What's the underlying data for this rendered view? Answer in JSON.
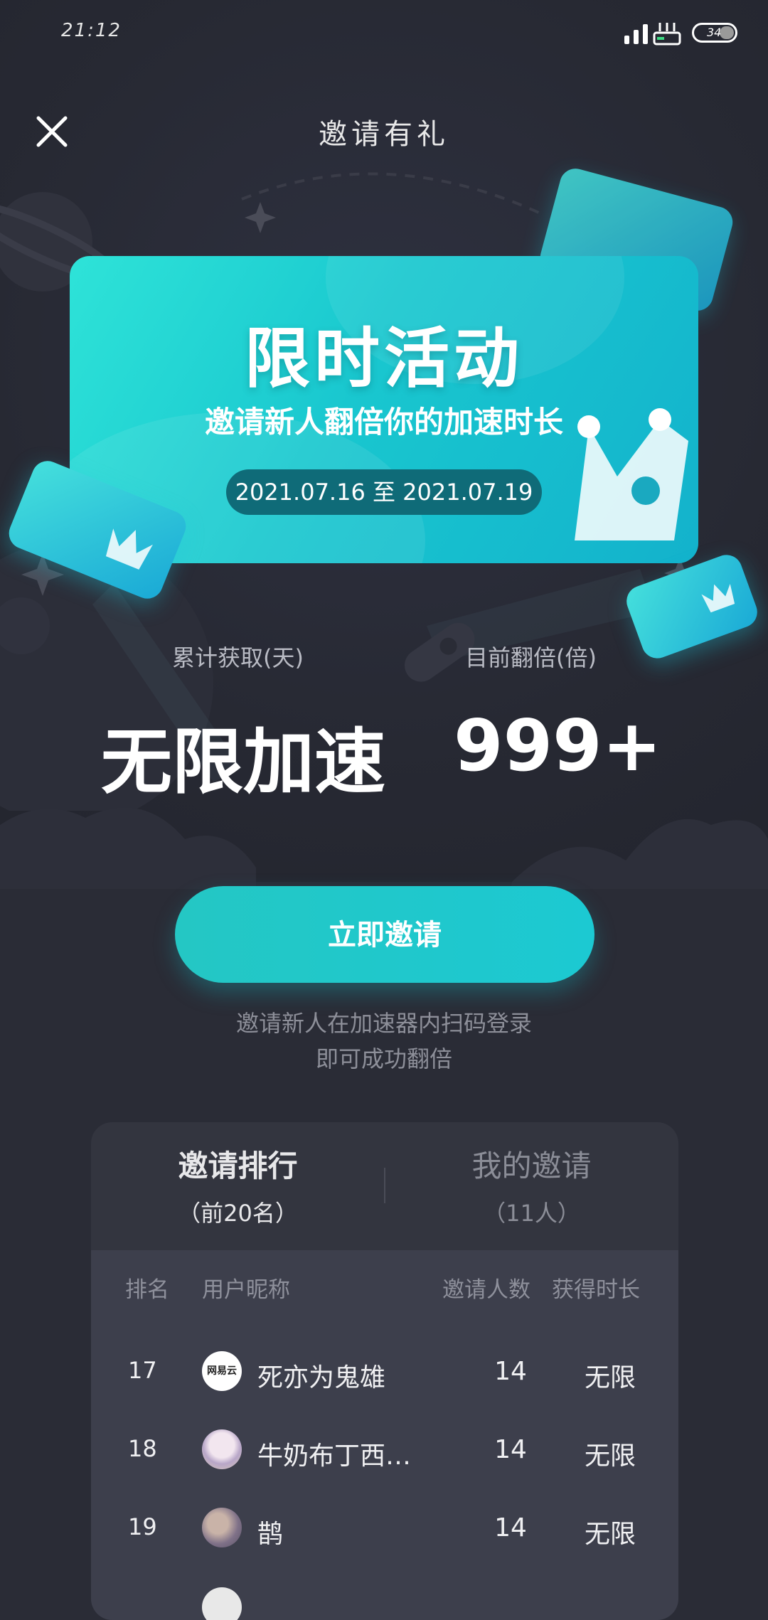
{
  "status_bar": {
    "time": "21:12",
    "battery": "34"
  },
  "header": {
    "title": "邀请有礼"
  },
  "banner": {
    "title": "限时活动",
    "subtitle": "邀请新人翻倍你的加速时长",
    "date_range": "2021.07.16 至 2021.07.19"
  },
  "stats": {
    "left_label": "累计获取(天)",
    "left_value": "无限加速",
    "right_label": "目前翻倍(倍)",
    "right_value": "999+"
  },
  "invite_button": "立即邀请",
  "hint": {
    "line1": "邀请新人在加速器内扫码登录",
    "line2": "即可成功翻倍"
  },
  "tabs": [
    {
      "label": "邀请排行",
      "sub": "（前20名）"
    },
    {
      "label": "我的邀请",
      "sub": "（11人）"
    }
  ],
  "table": {
    "headers": {
      "rank": "排名",
      "nickname": "用户昵称",
      "count": "邀请人数",
      "duration": "获得时长"
    },
    "rows": [
      {
        "rank": "17",
        "nickname": "死亦为鬼雄",
        "count": "14",
        "duration": "无限",
        "avatar": "网易云"
      },
      {
        "rank": "18",
        "nickname": "牛奶布丁西…",
        "count": "14",
        "duration": "无限"
      },
      {
        "rank": "19",
        "nickname": "鹊",
        "count": "14",
        "duration": "无限"
      }
    ]
  },
  "colors": {
    "accent": "#1fc8cf",
    "background": "#2a2c36",
    "panel": "#353743"
  }
}
